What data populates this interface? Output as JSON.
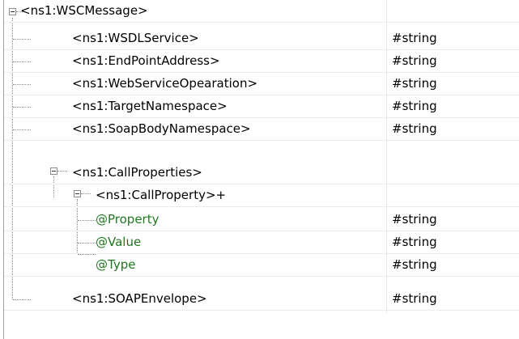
{
  "tree": {
    "rows": [
      {
        "label": "<ns1:WSCMessage>",
        "type": ""
      },
      {
        "label": "<ns1:WSDLService>",
        "type": "#string"
      },
      {
        "label": "<ns1:EndPointAddress>",
        "type": "#string"
      },
      {
        "label": "<ns1:WebServiceOpearation>",
        "type": "#string"
      },
      {
        "label": "<ns1:TargetNamespace>",
        "type": "#string"
      },
      {
        "label": "<ns1:SoapBodyNamespace>",
        "type": "#string"
      },
      {
        "label": "<ns1:CallProperties>",
        "type": ""
      },
      {
        "label": "<ns1:CallProperty>+",
        "type": ""
      },
      {
        "label": "@Property",
        "type": "#string"
      },
      {
        "label": "@Value",
        "type": "#string"
      },
      {
        "label": "@Type",
        "type": "#string"
      },
      {
        "label": "<ns1:SOAPEnvelope>",
        "type": "#string"
      }
    ]
  },
  "colors": {
    "attribute_text": "#1e7a1e",
    "tree_lines": "#8a8a8a"
  }
}
